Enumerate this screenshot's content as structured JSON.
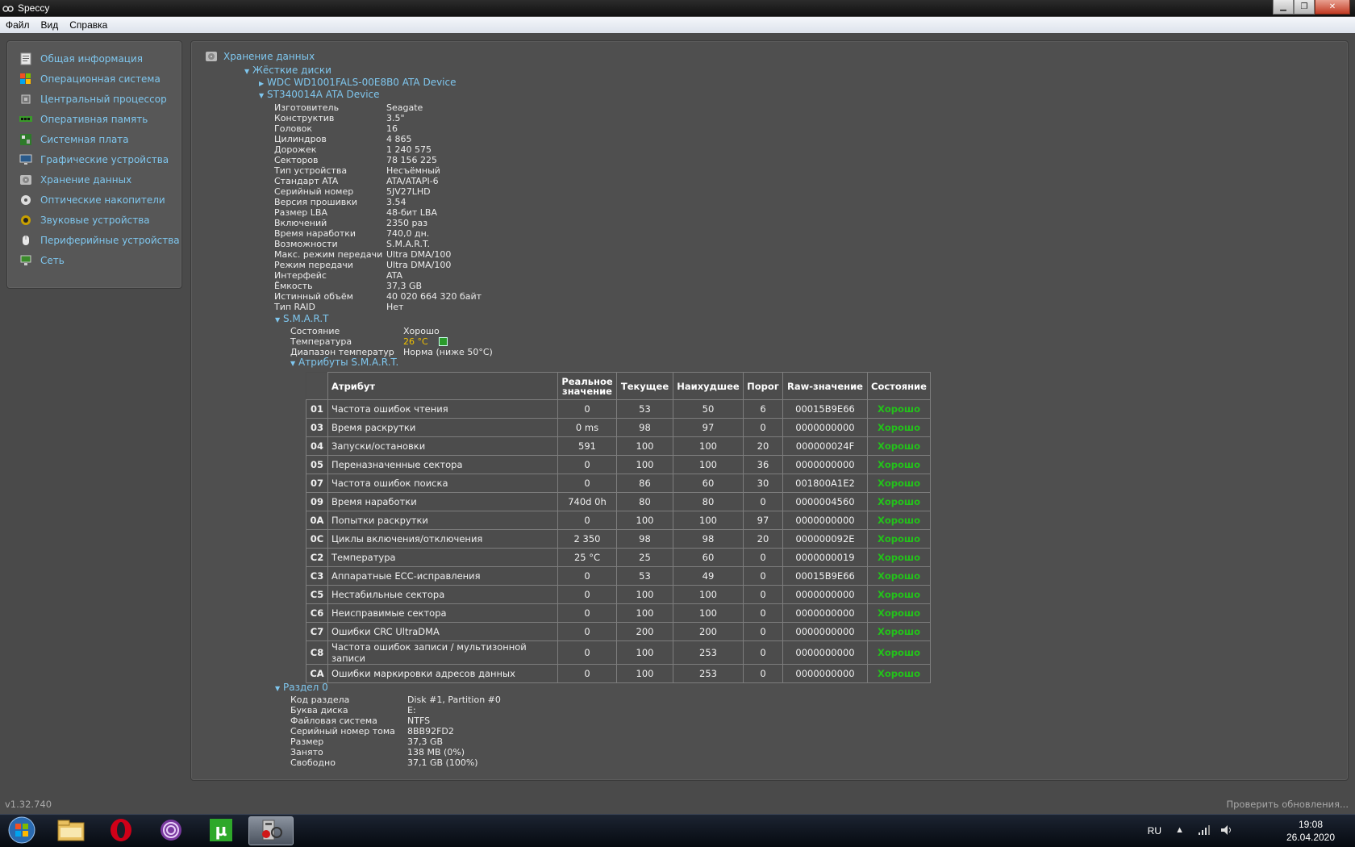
{
  "window": {
    "title": "Speccy"
  },
  "menu": [
    "Файл",
    "Вид",
    "Справка"
  ],
  "sidebar": [
    {
      "label": "Общая информация",
      "icon": "summary-icon"
    },
    {
      "label": "Операционная система",
      "icon": "windows-icon"
    },
    {
      "label": "Центральный процессор",
      "icon": "cpu-icon"
    },
    {
      "label": "Оперативная память",
      "icon": "ram-icon"
    },
    {
      "label": "Системная плата",
      "icon": "motherboard-icon"
    },
    {
      "label": "Графические устройства",
      "icon": "monitor-icon"
    },
    {
      "label": "Хранение данных",
      "icon": "storage-icon"
    },
    {
      "label": "Оптические накопители",
      "icon": "optical-disc-icon"
    },
    {
      "label": "Звуковые устройства",
      "icon": "speaker-icon"
    },
    {
      "label": "Периферийные устройства",
      "icon": "mouse-icon"
    },
    {
      "label": "Сеть",
      "icon": "network-icon"
    }
  ],
  "tree": {
    "root": "Хранение данных",
    "hdd_group": "Жёсткие диски",
    "disk1": "WDC WD1001FALS-00E8B0 ATA Device",
    "disk2": "ST340014A ATA Device"
  },
  "disk_props": [
    [
      "Изготовитель",
      "Seagate"
    ],
    [
      "Конструктив",
      "3.5\""
    ],
    [
      "Головок",
      "16"
    ],
    [
      "Цилиндров",
      "4 865"
    ],
    [
      "Дорожек",
      "1 240 575"
    ],
    [
      "Секторов",
      "78 156 225"
    ],
    [
      "Тип устройства",
      "Несъёмный"
    ],
    [
      "Стандарт ATA",
      "ATA/ATAPI-6"
    ],
    [
      "Серийный номер",
      "5JV27LHD"
    ],
    [
      "Версия прошивки",
      "3.54"
    ],
    [
      "Размер LBA",
      "48-бит LBA"
    ],
    [
      "Включений",
      "2350 раз"
    ],
    [
      "Время наработки",
      "740,0 дн."
    ],
    [
      "Возможности",
      "S.M.A.R.T."
    ],
    [
      "Макс. режим передачи",
      "Ultra DMA/100"
    ],
    [
      "Режим передачи",
      "Ultra DMA/100"
    ],
    [
      "Интерфейс",
      "ATA"
    ],
    [
      "Ёмкость",
      "37,3 GB"
    ],
    [
      "Истинный объём",
      "40 020 664 320 байт"
    ],
    [
      "Тип RAID",
      "Нет"
    ]
  ],
  "smart": {
    "title": "S.M.A.R.T",
    "status_label": "Состояние",
    "status_value": "Хорошо",
    "temp_label": "Температура",
    "temp_value": "26 °C",
    "temp_color": "#f0c000",
    "range_label": "Диапазон температур",
    "range_value": "Норма (ниже 50°C)",
    "attrs_title": "Атрибуты S.M.A.R.T.",
    "columns": [
      "Атрибут",
      "Реальное значение",
      "Текущее",
      "Наихудшее",
      "Порог",
      "Raw-значение",
      "Состояние"
    ],
    "rows": [
      [
        "01",
        "Частота ошибок чтения",
        "0",
        "53",
        "50",
        "6",
        "00015B9E66",
        "Хорошо"
      ],
      [
        "03",
        "Время раскрутки",
        "0 ms",
        "98",
        "97",
        "0",
        "0000000000",
        "Хорошо"
      ],
      [
        "04",
        "Запуски/остановки",
        "591",
        "100",
        "100",
        "20",
        "000000024F",
        "Хорошо"
      ],
      [
        "05",
        "Переназначенные сектора",
        "0",
        "100",
        "100",
        "36",
        "0000000000",
        "Хорошо"
      ],
      [
        "07",
        "Частота ошибок поиска",
        "0",
        "86",
        "60",
        "30",
        "001800A1E2",
        "Хорошо"
      ],
      [
        "09",
        "Время наработки",
        "740d 0h",
        "80",
        "80",
        "0",
        "0000004560",
        "Хорошо"
      ],
      [
        "0A",
        "Попытки раскрутки",
        "0",
        "100",
        "100",
        "97",
        "0000000000",
        "Хорошо"
      ],
      [
        "0C",
        "Циклы включения/отключения",
        "2 350",
        "98",
        "98",
        "20",
        "000000092E",
        "Хорошо"
      ],
      [
        "C2",
        "Температура",
        "25 °C",
        "25",
        "60",
        "0",
        "0000000019",
        "Хорошо"
      ],
      [
        "C3",
        "Аппаратные ECC-исправления",
        "0",
        "53",
        "49",
        "0",
        "00015B9E66",
        "Хорошо"
      ],
      [
        "C5",
        "Нестабильные сектора",
        "0",
        "100",
        "100",
        "0",
        "0000000000",
        "Хорошо"
      ],
      [
        "C6",
        "Неисправимые сектора",
        "0",
        "100",
        "100",
        "0",
        "0000000000",
        "Хорошо"
      ],
      [
        "C7",
        "Ошибки CRC UltraDMA",
        "0",
        "200",
        "200",
        "0",
        "0000000000",
        "Хорошо"
      ],
      [
        "C8",
        "Частота ошибок записи / мультизонной записи",
        "0",
        "100",
        "253",
        "0",
        "0000000000",
        "Хорошо"
      ],
      [
        "CA",
        "Ошибки маркировки адресов данных",
        "0",
        "100",
        "253",
        "0",
        "0000000000",
        "Хорошо"
      ]
    ]
  },
  "partition": {
    "title": "Раздел 0",
    "props": [
      [
        "Код раздела",
        "Disk #1, Partition #0"
      ],
      [
        "Буква диска",
        "E:"
      ],
      [
        "Файловая система",
        "NTFS"
      ],
      [
        "Серийный номер тома",
        "8BB92FD2"
      ],
      [
        "Размер",
        "37,3 GB"
      ],
      [
        "Занято",
        "138 MB (0%)"
      ],
      [
        "Свободно",
        "37,1 GB (100%)"
      ]
    ]
  },
  "statusbar": {
    "version": "v1.32.740",
    "update": "Проверить обновления..."
  },
  "taskbar": {
    "apps": [
      "explorer-icon",
      "opera-icon",
      "tor-icon",
      "utorrent-icon",
      "speccy-icon"
    ],
    "lang": "RU",
    "time": "19:08",
    "date": "26.04.2020"
  }
}
